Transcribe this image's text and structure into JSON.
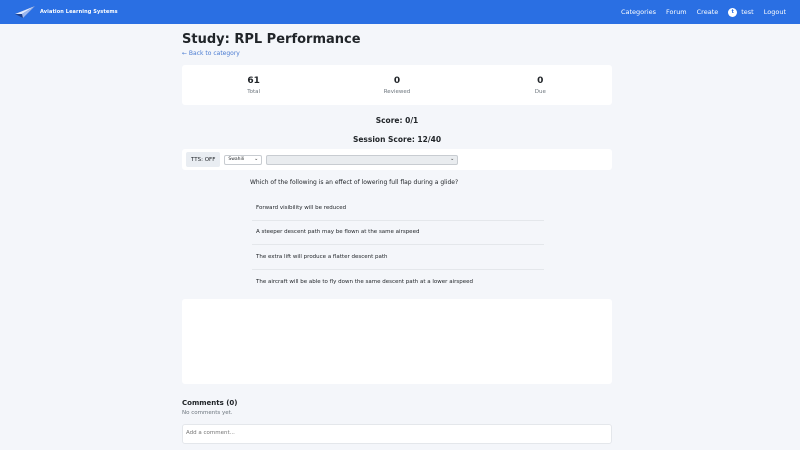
{
  "navbar": {
    "brand": "Aviation Learning Systems",
    "links": [
      "Categories",
      "Forum",
      "Create"
    ],
    "user_initial": "t",
    "username": "test",
    "logout": "Logout"
  },
  "page": {
    "title": "Study: RPL Performance",
    "back_link": "← Back to category"
  },
  "stats": [
    {
      "value": "61",
      "label": "Total"
    },
    {
      "value": "0",
      "label": "Reviewed"
    },
    {
      "value": "0",
      "label": "Due"
    }
  ],
  "score": "Score: 0/1",
  "session_score": "Session Score: 12/40",
  "tts": {
    "button": "TTS: OFF",
    "language": "Swahili",
    "voice": ""
  },
  "question": {
    "text": "Which of the following is an effect of lowering full flap during a glide?",
    "options": [
      "Forward visibility will be reduced",
      "A steeper descent path may be flown at the same airspeed",
      "The extra lift will produce a flatter descent path",
      "The aircraft will be able to fly down the same descent path at a lower airspeed"
    ]
  },
  "comments": {
    "title": "Comments (0)",
    "empty": "No comments yet.",
    "placeholder": "Add a comment..."
  },
  "colors": {
    "navbar": "#2a6fe3",
    "background": "#f4f6fa",
    "link": "#4a7bd1"
  }
}
